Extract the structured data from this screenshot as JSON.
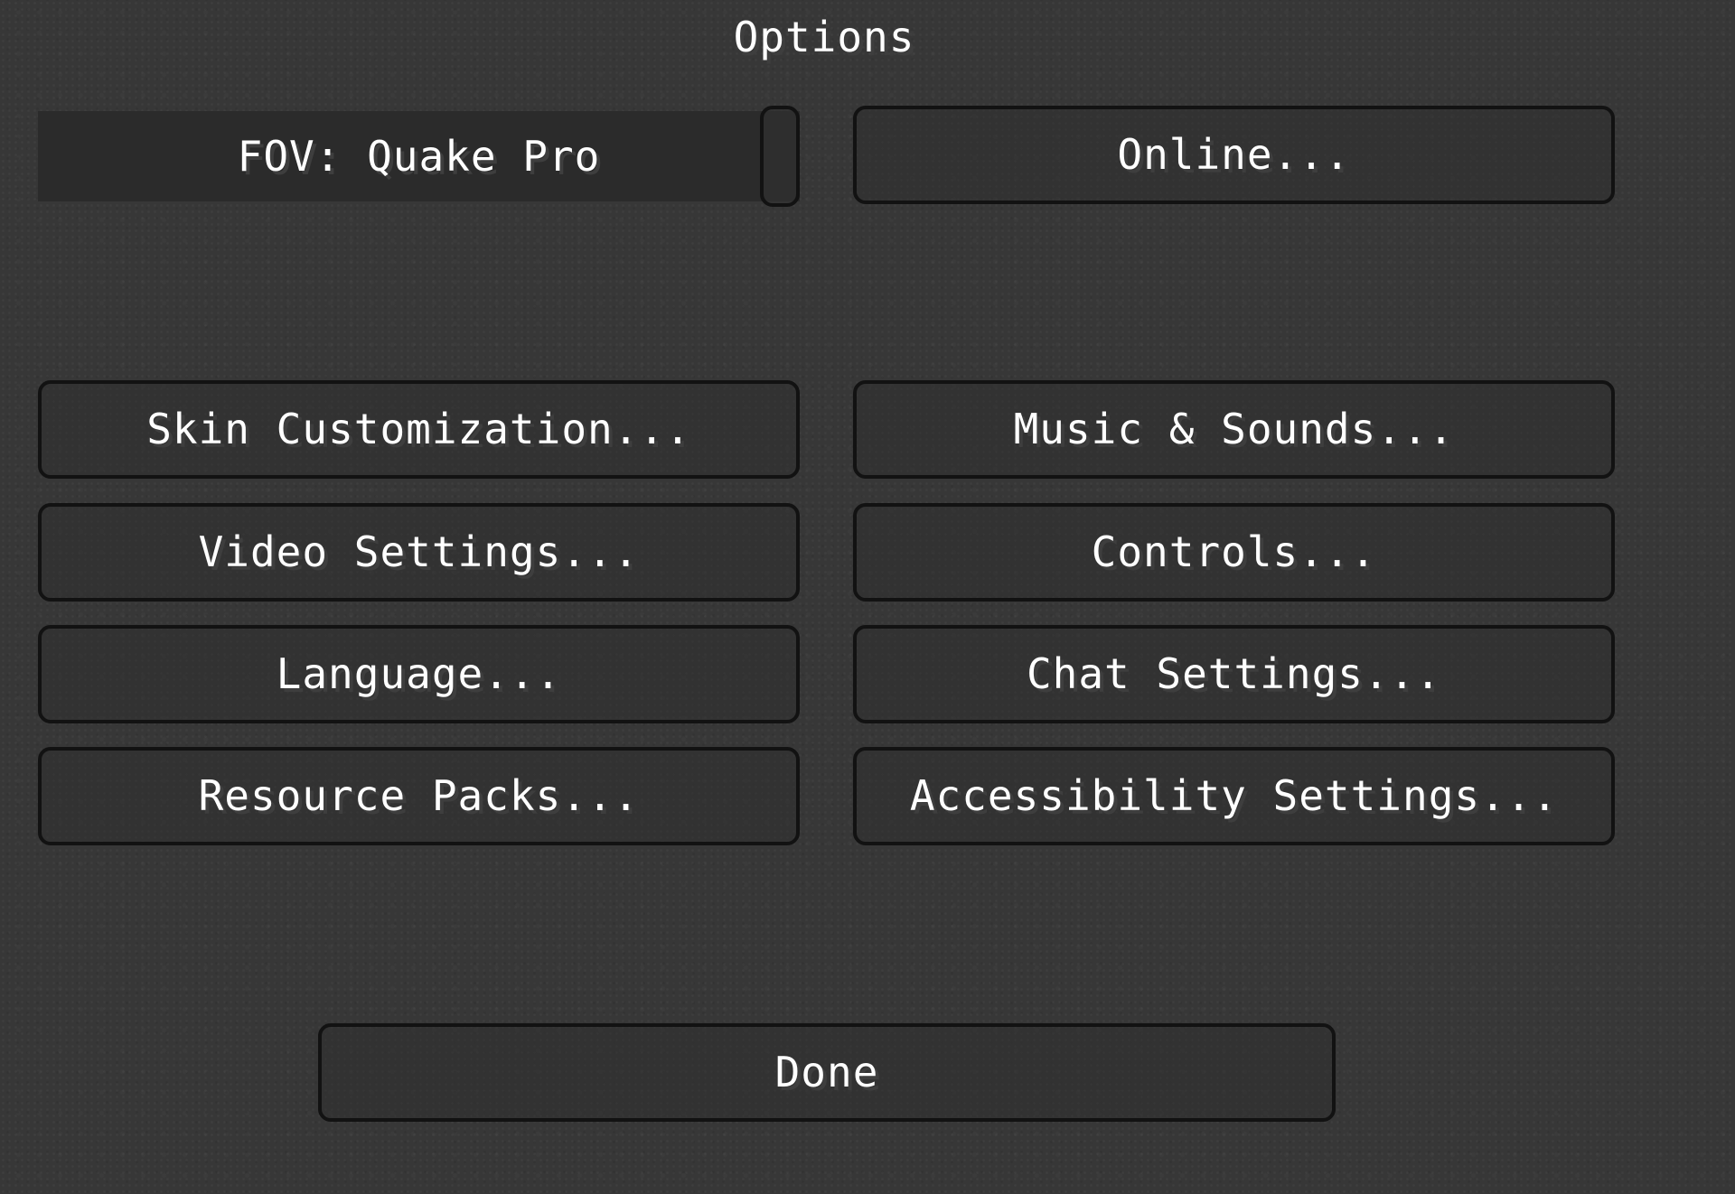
{
  "screen": {
    "title": "Options"
  },
  "fov_slider": {
    "label": "FOV: Quake Pro",
    "value_fraction": 1.0
  },
  "buttons": {
    "online": "Online...",
    "skin_customization": "Skin Customization...",
    "music_sounds": "Music & Sounds...",
    "video_settings": "Video Settings...",
    "controls": "Controls...",
    "language": "Language...",
    "chat_settings": "Chat Settings...",
    "resource_packs": "Resource Packs...",
    "accessibility_settings": "Accessibility Settings...",
    "done": "Done"
  },
  "colors": {
    "background": "#373737",
    "button_border": "#121212",
    "text": "#ffffff",
    "text_shadow": "#3e3e3e"
  }
}
